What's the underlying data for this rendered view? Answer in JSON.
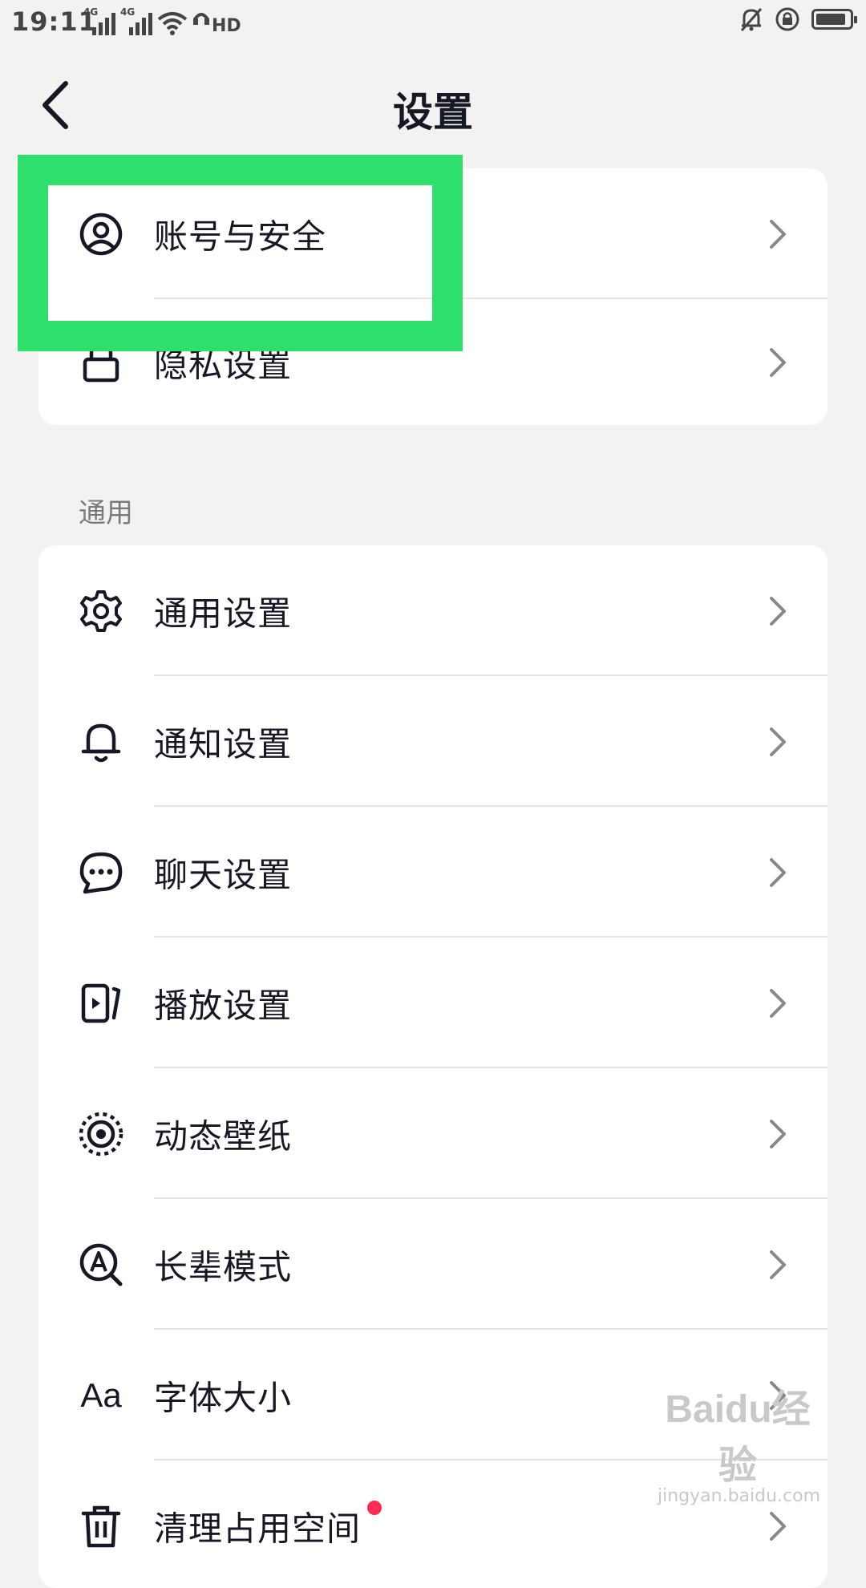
{
  "status_bar": {
    "time": "19:11",
    "signal_1": "4G",
    "signal_2": "4G",
    "hd_label": "HD",
    "icons": [
      "wifi-icon",
      "hd-voice-icon",
      "mute-bell-icon",
      "rotation-lock-icon",
      "battery-icon"
    ]
  },
  "header": {
    "title": "设置",
    "back_icon": "chevron-left-icon"
  },
  "account_section": {
    "items": [
      {
        "label": "账号与安全",
        "icon": "user-circle-icon"
      },
      {
        "label": "隐私设置",
        "icon": "lock-icon"
      }
    ]
  },
  "general_section": {
    "title": "通用",
    "items": [
      {
        "label": "通用设置",
        "icon": "gear-icon"
      },
      {
        "label": "通知设置",
        "icon": "bell-icon"
      },
      {
        "label": "聊天设置",
        "icon": "chat-bubble-icon"
      },
      {
        "label": "播放设置",
        "icon": "play-screen-icon"
      },
      {
        "label": "动态壁纸",
        "icon": "live-wallpaper-icon"
      },
      {
        "label": "长辈模式",
        "icon": "elder-mode-icon"
      },
      {
        "label": "字体大小",
        "icon": "font-size-icon",
        "icon_text": "Aa"
      },
      {
        "label": "清理占用空间",
        "icon": "trash-icon",
        "badge": "red-dot"
      }
    ]
  },
  "highlight_color": "#2ee06b",
  "watermark": {
    "logo": "Baidu经验",
    "url": "jingyan.baidu.com"
  },
  "colors": {
    "background": "#f2f2f2",
    "card": "#ffffff",
    "text": "#161823",
    "badge": "#fe2c55"
  }
}
